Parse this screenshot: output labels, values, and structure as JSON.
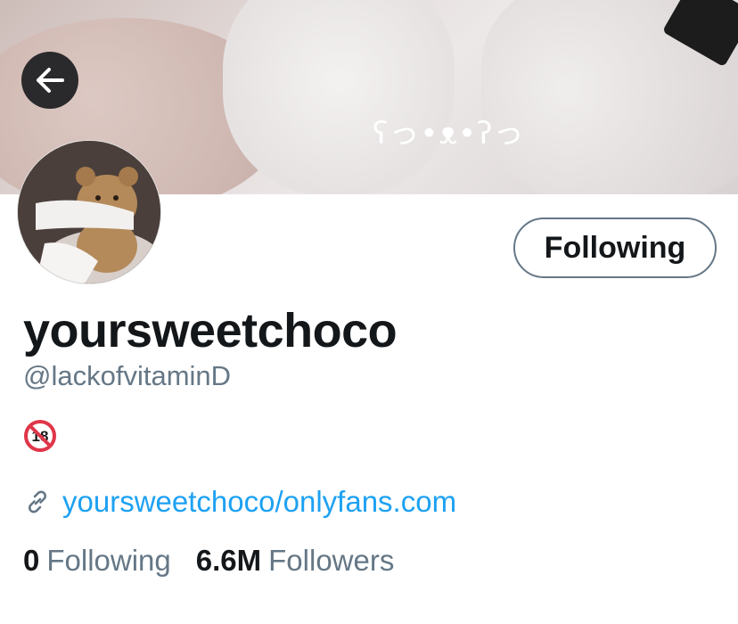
{
  "banner": {
    "kaomoji": "ʕっ•ᴥ•ʔっ"
  },
  "profile": {
    "display_name": "yoursweetchoco",
    "handle": "@lackofvitaminD",
    "bio_emoji": "no-one-under-eighteen-icon",
    "bio_emoji_text": "18",
    "link": "yoursweetchoco/onlyfans.com",
    "follow_button": "Following"
  },
  "stats": {
    "following_count": "0",
    "following_label": "Following",
    "followers_count": "6.6M",
    "followers_label": "Followers"
  },
  "colors": {
    "link": "#1da1f2",
    "secondary_text": "#657786",
    "primary_text": "#14171a"
  }
}
